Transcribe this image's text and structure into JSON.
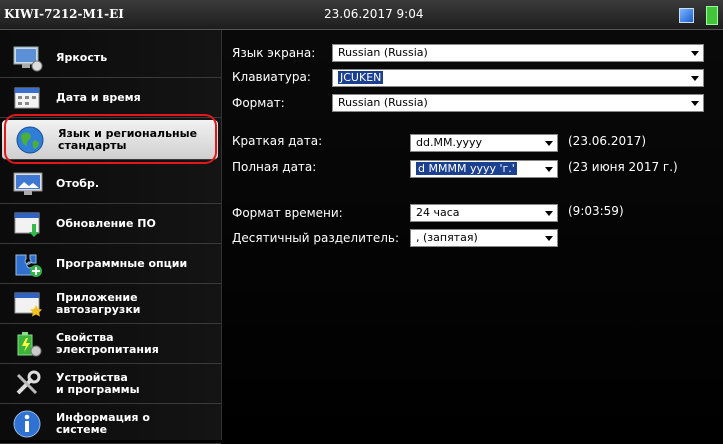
{
  "topbar": {
    "device": "KIWI-7212-M1-EI",
    "datetime": "23.06.2017 9:04",
    "blue_icon": "blue-square-icon",
    "battery_icon": "battery-icon",
    "battery_color": "#43c43a"
  },
  "sidebar": {
    "items": [
      {
        "label": "Яркость",
        "icon": "brightness-icon"
      },
      {
        "label": "Дата и время",
        "icon": "calendar-icon"
      },
      {
        "label": "Язык и региональные\nстандарты",
        "icon": "globe-icon",
        "selected": true
      },
      {
        "label": "Отобр.",
        "icon": "display-icon"
      },
      {
        "label": "Обновление ПО",
        "icon": "software-update-icon"
      },
      {
        "label": "Программные опции",
        "icon": "puzzle-icon"
      },
      {
        "label": "Приложение\nавтозагрузки",
        "icon": "startup-app-icon"
      },
      {
        "label": "Свойства\nэлектропитания",
        "icon": "power-icon"
      },
      {
        "label": "Устройства\nи программы",
        "icon": "tools-icon"
      },
      {
        "label": "Информация о\nсистеме",
        "icon": "info-icon"
      }
    ],
    "highlight_color": "#e0181e"
  },
  "main": {
    "screen_language": {
      "label": "Язык экрана:",
      "value": "Russian (Russia)"
    },
    "keyboard": {
      "label": "Клавиатура:",
      "value": "JCUKEN"
    },
    "format": {
      "label": "Формат:",
      "value": "Russian (Russia)"
    },
    "short_date": {
      "label": "Краткая дата:",
      "value": "dd.MM.yyyy",
      "preview": "(23.06.2017)"
    },
    "long_date": {
      "label": "Полная дата:",
      "value": "d MMMM yyyy 'г.'",
      "preview": "(23 июня 2017 г.)"
    },
    "time_format": {
      "label": "Формат времени:",
      "value": "24 часа",
      "preview": "(9:03:59)"
    },
    "decimal_separator": {
      "label": "Десятичный разделитель:",
      "value": ", (запятая)"
    }
  }
}
